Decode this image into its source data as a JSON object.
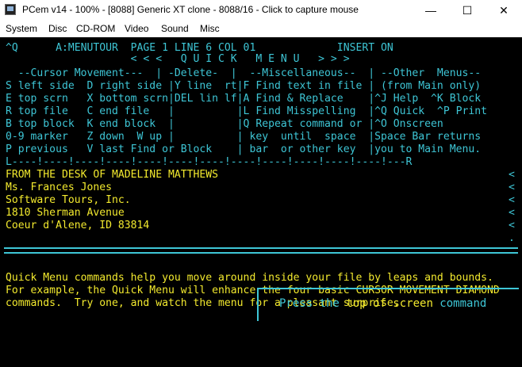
{
  "window": {
    "title": "PCem v14 - 100% - [8088] Generic XT clone - 8088/16 - Click to capture mouse",
    "minimize": "—",
    "maximize": "☐",
    "close": "✕"
  },
  "menubar": [
    "System",
    "Disc",
    "CD-ROM",
    "Video",
    "Sound",
    "Misc"
  ],
  "screen": {
    "status_line": "^Q      A:MENUTOUR  PAGE 1 LINE 6 COL 01             INSERT ON",
    "menu_title": "                    < < <   Q U I C K   M E N U   > > >",
    "header_row": "  --Cursor Movement---  | -Delete-  |  --Miscellaneous--  | --Other  Menus--",
    "menu_rows": [
      "S left side  D right side |Y line  rt|F Find text in file | (from Main only)",
      "E top scrn   X bottom scrn|DEL lin lf|A Find & Replace    |^J Help  ^K Block",
      "R top file   C end file   |          |L Find Misspelling  |^Q Quick  ^P Print",
      "B top block  K end block  |          |Q Repeat command or |^O Onscreen",
      "0-9 marker   Z down  W up |          | key  until  space  |Space Bar returns",
      "P previous   V last Find or Block    | bar  or other key  |you to Main Menu."
    ],
    "ruler": "L----!----!----!----!----!----!----!----!----!----!----!----!---R",
    "document_lines": [
      "FROM THE DESK OF MADELINE MATTHEWS",
      "Ms. Frances Jones",
      "Software Tours, Inc.",
      "1810 Sherman Avenue",
      "Coeur d'Alene, ID 83814"
    ],
    "flag_char": "<",
    "end_flag": ".",
    "description_lines": [
      "Quick Menu commands help you move around inside your file by leaps and bounds.",
      "For example, the Quick Menu will enhance the four basic CURSOR MOVEMENT DIAMOND",
      "commands.  Try one, and watch the menu for a pleasant surprise."
    ],
    "press_prefix": "Press the ",
    "press_highlight": "top of screen",
    "press_suffix": " command"
  },
  "colors": {
    "screen_bg": "#000000",
    "cyan": "#3ec6d6",
    "yellow": "#f3ea2e"
  }
}
